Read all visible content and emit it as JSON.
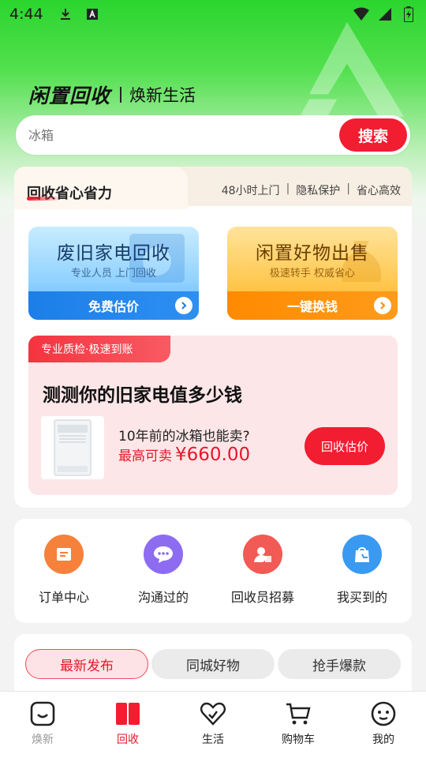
{
  "status_bar": {
    "time": "4:44"
  },
  "brand": {
    "name": "闲置回收",
    "slogan": "焕新生活"
  },
  "search": {
    "placeholder": "冰箱",
    "button_label": "搜索"
  },
  "recycle_section": {
    "title": "回收省心省力",
    "features": [
      "48小时上门",
      "隐私保护",
      "省心高效"
    ],
    "feature_separator": "|",
    "options": [
      {
        "title": "废旧家电回收",
        "subtitle": "专业人员 上门回收",
        "action": "免费估价",
        "color": "#1c7ee8"
      },
      {
        "title": "闲置好物出售",
        "subtitle": "极速转手 权威省心",
        "action": "一键换钱",
        "color": "#ff8a00"
      }
    ],
    "estimate": {
      "tag": "专业质检·极速到账",
      "title": "测测你的旧家电值多少钱",
      "product_name": "10年前的冰箱也能卖?",
      "price_label": "最高可卖",
      "price_value": "¥660.00",
      "button_label": "回收估价"
    }
  },
  "quick_menu": [
    {
      "label": "订单中心",
      "icon": "order-icon",
      "color": "#f6813a"
    },
    {
      "label": "沟通过的",
      "icon": "chat-icon",
      "color": "#8d6cf2"
    },
    {
      "label": "回收员招募",
      "icon": "recruit-icon",
      "color": "#f25a55"
    },
    {
      "label": "我买到的",
      "icon": "shopping-bag-icon",
      "color": "#3a9af2"
    }
  ],
  "tabs": [
    "最新发布",
    "同城好物",
    "抢手爆款"
  ],
  "active_tab": "最新发布",
  "bottom_nav": [
    {
      "label": "焕新",
      "icon": "renew-icon",
      "state": "inactive"
    },
    {
      "label": "回收",
      "icon": "recycle-book-icon",
      "state": "active"
    },
    {
      "label": "生活",
      "icon": "heart-icon",
      "state": "normal"
    },
    {
      "label": "购物车",
      "icon": "cart-icon",
      "state": "normal"
    },
    {
      "label": "我的",
      "icon": "profile-icon",
      "state": "normal"
    }
  ],
  "colors": {
    "accent": "#f21d31",
    "green": "#2bd52d"
  }
}
